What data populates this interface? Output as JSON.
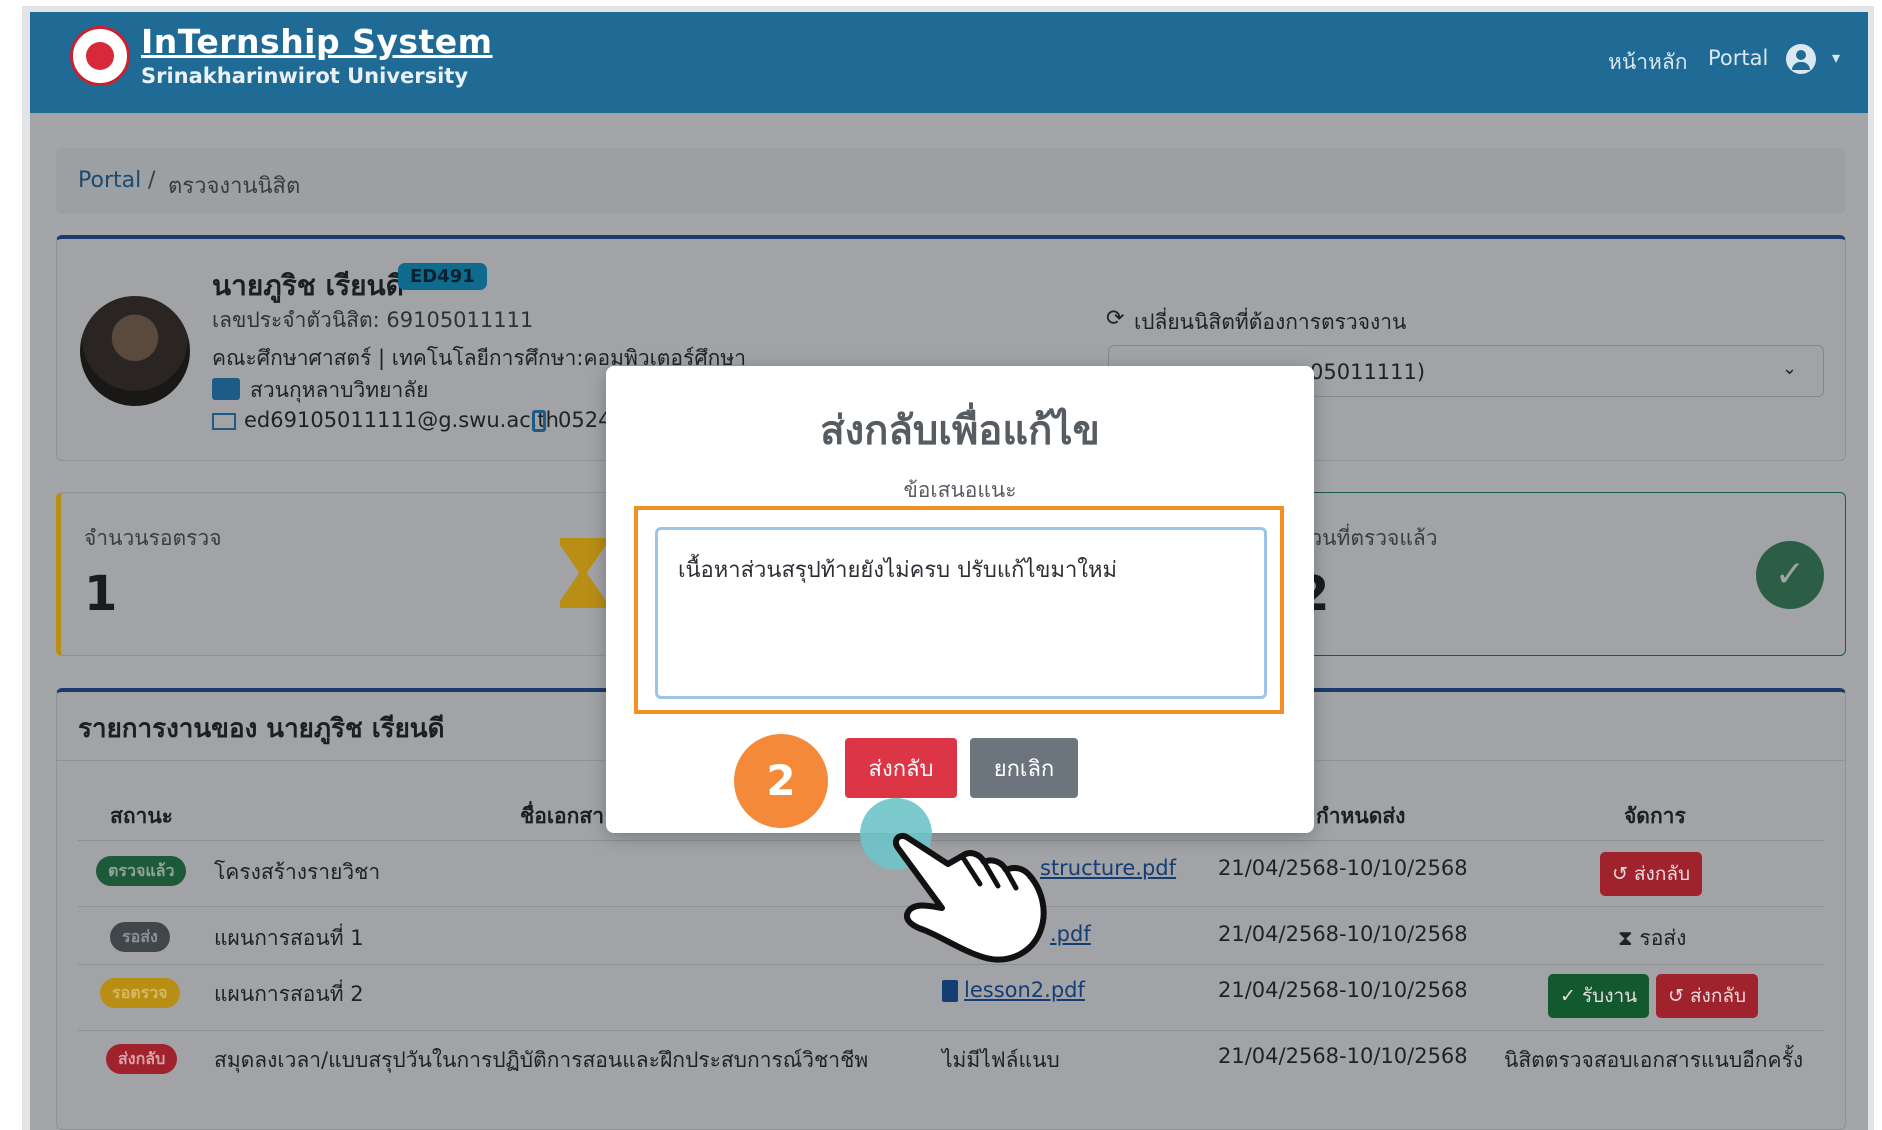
{
  "header": {
    "brand_title": "InTernship System",
    "brand_subtitle": "Srinakharinwirot University",
    "nav_home": "หน้าหลัก",
    "nav_portal": "Portal",
    "nav_caret": "▾"
  },
  "breadcrumb": {
    "portal": "Portal",
    "separator": "/",
    "current": "ตรวจงานนิสิต"
  },
  "student": {
    "name": "นายภูริช เรียนดี",
    "badge": "ED491",
    "id_line": "เลขประจำตัวนิสิต: 69105011111",
    "faculty": "คณะศึกษาศาสตร์ | เทคโนโลยีการศึกษา:คอมพิวเตอร์ศึกษา",
    "campus": "สวนกุหลาบวิทยาลัย",
    "email": "ed69105011111@g.swu.ac.th",
    "phone": "0524"
  },
  "switcher": {
    "icon": "sync-icon",
    "label": "เปลี่ยนนิสิตที่ต้องการตรวจงาน",
    "visible_value": "05011111)",
    "caret": "⌄"
  },
  "stats": {
    "pending_label": "จำนวนรอตรวจ",
    "pending_value": "1",
    "done_label": "นวนที่ตรวจแล้ว",
    "done_value": "2",
    "done_icon": "✓"
  },
  "list": {
    "title": "รายการงานของ นายภูริช เรียนดี",
    "headers": {
      "status": "สถานะ",
      "doc": "ชื่อเอกสา",
      "due": "กำหนดส่ง",
      "manage": "จัดการ"
    },
    "rows": [
      {
        "status": "ตรวจแล้ว",
        "name": "โครงสร้างรายวิชา",
        "file": "structure.pdf",
        "due": "21/04/2568-10/10/2568",
        "action1": "↺ ส่งกลับ"
      },
      {
        "status": "รอส่ง",
        "name": "แผนการสอนที่ 1",
        "file": ".pdf",
        "due": "21/04/2568-10/10/2568",
        "action1": "⧗ รอส่ง"
      },
      {
        "status": "รอตรวจ",
        "name": "แผนการสอนที่ 2",
        "file": "lesson2.pdf",
        "due": "21/04/2568-10/10/2568",
        "action1": "✓ รับงาน",
        "action2": "↺ ส่งกลับ"
      },
      {
        "status": "ส่งกลับ",
        "name": "สมุดลงเวลา/แบบสรุปวันในการปฏิบัติการสอนและฝึกประสบการณ์วิชาชีพ",
        "file": "ไม่มีไฟล์แนบ",
        "due": "21/04/2568-10/10/2568",
        "action1": "นิสิตตรวจสอบเอกสารแนบอีกครั้ง"
      }
    ]
  },
  "modal": {
    "title": "ส่งกลับเพื่อแก้ไข",
    "label": "ข้อเสนอแนะ",
    "textarea_value": "เนื้อหาส่วนสรุปท้ายยังไม่ครบ ปรับแก้ไขมาใหม่",
    "send_label": "ส่งกลับ",
    "cancel_label": "ยกเลิก"
  },
  "annotation": {
    "step_number": "2"
  },
  "colors": {
    "topbar": "#1f6b96",
    "danger": "#dc3545",
    "secondary": "#6c757d",
    "highlight": "#f39025",
    "step_badge": "#f4893a",
    "tap_circle": "#6ec4c9"
  }
}
